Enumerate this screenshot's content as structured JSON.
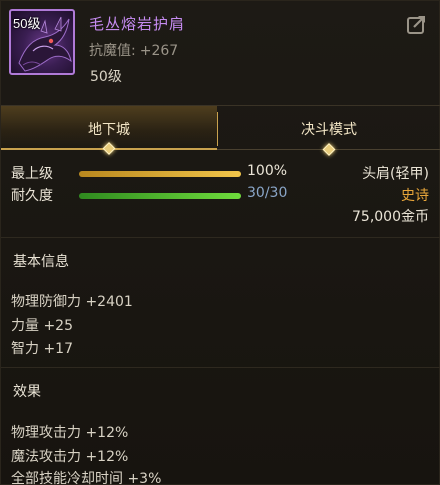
{
  "item": {
    "level_badge": "50级",
    "name": "毛丛熔岩护肩",
    "stat_label": "抗魔值:",
    "stat_value": "+267",
    "required_level": "50级",
    "name_color": "#c58bf0"
  },
  "tabs": [
    {
      "label": "地下城",
      "active": true
    },
    {
      "label": "决斗模式",
      "active": false
    }
  ],
  "bars": [
    {
      "label": "最上级",
      "fill": 1.0,
      "value": "100%",
      "color": "gold"
    },
    {
      "label": "耐久度",
      "fill": 1.0,
      "value": "30/30",
      "color": "green"
    }
  ],
  "info": {
    "slot": "头肩(轻甲)",
    "rarity": "史诗",
    "price": "75,000金币",
    "rarity_color": "#e8a63a"
  },
  "basic": {
    "title": "基本信息",
    "lines": [
      "物理防御力 +2401",
      "力量 +25",
      "智力 +17"
    ]
  },
  "effects": {
    "title": "效果",
    "lines": [
      "物理攻击力 +12%",
      "魔法攻击力 +12%",
      "全部技能冷却时间 +3%"
    ]
  },
  "icons": {
    "item_icon": "dragon-shoulder-icon",
    "share_icon": "share-arrow-icon"
  }
}
